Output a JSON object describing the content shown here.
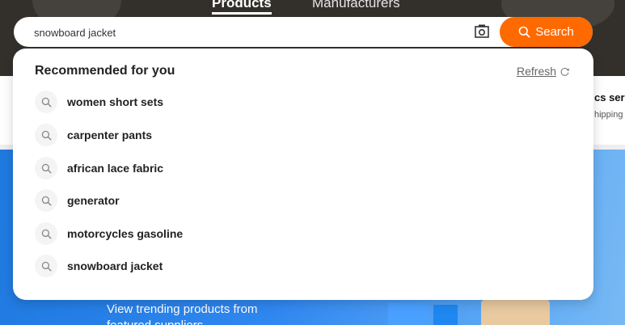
{
  "header": {
    "tabs": [
      {
        "label": "Products",
        "active": true
      },
      {
        "label": "Manufacturers",
        "active": false
      }
    ]
  },
  "search": {
    "value": "snowboard jacket",
    "button_label": "Search",
    "camera_icon": "camera-icon",
    "accent_color": "#ff6a00"
  },
  "recommendations": {
    "title": "Recommended for you",
    "refresh_label": "Refresh",
    "items": [
      {
        "label": "women short sets"
      },
      {
        "label": "carpenter pants"
      },
      {
        "label": "african lace fabric"
      },
      {
        "label": "generator"
      },
      {
        "label": "motorcycles gasoline"
      },
      {
        "label": "snowboard jacket"
      }
    ]
  },
  "background": {
    "services_title": "cs ser",
    "services_subtitle": "hipping",
    "banner_text": "View trending products from featured suppliers"
  }
}
